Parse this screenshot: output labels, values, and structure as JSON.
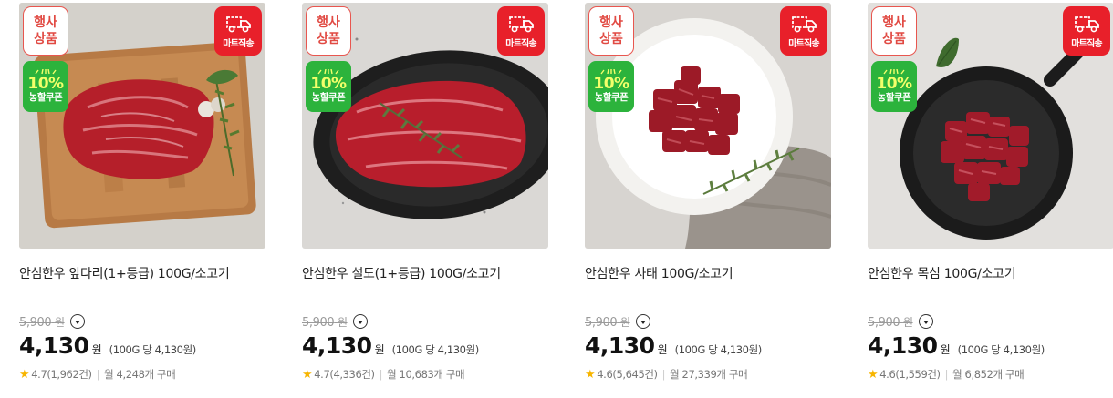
{
  "products": [
    {
      "title": "안심한우 앞다리(1+등급) 100G/소고기",
      "badge_event": [
        "행사",
        "상품"
      ],
      "badge_coupon": {
        "percent": "10%",
        "label": "농할쿠폰"
      },
      "badge_mart": "마트직송",
      "original_price": "5,900",
      "original_unit": "원",
      "price": "4,130",
      "price_unit": "원",
      "unit_price": "(100G 당 4,130원)",
      "rating": "4.7",
      "reviews": "(1,962건)",
      "monthly": "월 4,248개 구매"
    },
    {
      "title": "안심한우 설도(1+등급) 100G/소고기",
      "badge_event": [
        "행사",
        "상품"
      ],
      "badge_coupon": {
        "percent": "10%",
        "label": "농할쿠폰"
      },
      "badge_mart": "마트직송",
      "original_price": "5,900",
      "original_unit": "원",
      "price": "4,130",
      "price_unit": "원",
      "unit_price": "(100G 당 4,130원)",
      "rating": "4.7",
      "reviews": "(4,336건)",
      "monthly": "월 10,683개 구매"
    },
    {
      "title": "안심한우 사태 100G/소고기",
      "badge_event": [
        "행사",
        "상품"
      ],
      "badge_coupon": {
        "percent": "10%",
        "label": "농할쿠폰"
      },
      "badge_mart": "마트직송",
      "original_price": "5,900",
      "original_unit": "원",
      "price": "4,130",
      "price_unit": "원",
      "unit_price": "(100G 당 4,130원)",
      "rating": "4.6",
      "reviews": "(5,645건)",
      "monthly": "월 27,339개 구매"
    },
    {
      "title": "안심한우 목심 100G/소고기",
      "badge_event": [
        "행사",
        "상품"
      ],
      "badge_coupon": {
        "percent": "10%",
        "label": "농할쿠폰"
      },
      "badge_mart": "마트직송",
      "original_price": "5,900",
      "original_unit": "원",
      "price": "4,130",
      "price_unit": "원",
      "unit_price": "(100G 당 4,130원)",
      "rating": "4.6",
      "reviews": "(1,559건)",
      "monthly": "월 6,852개 구매"
    }
  ],
  "icons": {
    "star": "star-icon",
    "toggle": "chevron-down-icon",
    "truck": "delivery-truck-icon"
  },
  "colors": {
    "event_badge": "#e14a43",
    "coupon_badge": "#2cb33c",
    "mart_badge": "#e8202a",
    "star": "#f7b500"
  }
}
